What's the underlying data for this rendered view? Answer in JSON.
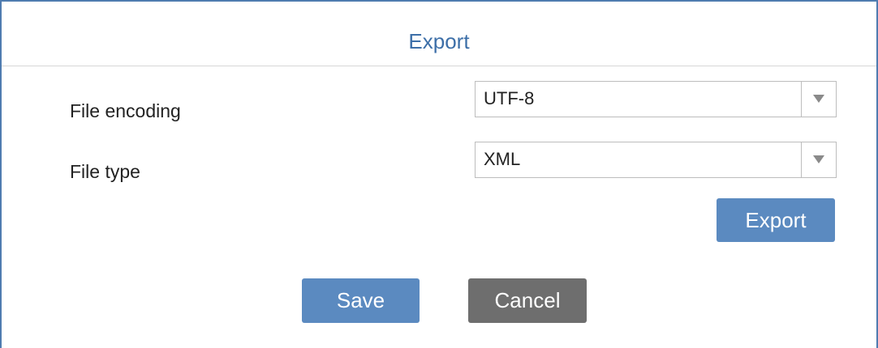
{
  "dialog": {
    "title": "Export"
  },
  "form": {
    "file_encoding": {
      "label": "File encoding",
      "value": "UTF-8"
    },
    "file_type": {
      "label": "File type",
      "value": "XML"
    },
    "export_label": "Export"
  },
  "footer": {
    "save_label": "Save",
    "cancel_label": "Cancel"
  },
  "colors": {
    "title": "#3d6fa8",
    "frame_border": "#4f7cb0",
    "primary_button": "#5b8ac0",
    "secondary_button": "#6e6e6e"
  }
}
